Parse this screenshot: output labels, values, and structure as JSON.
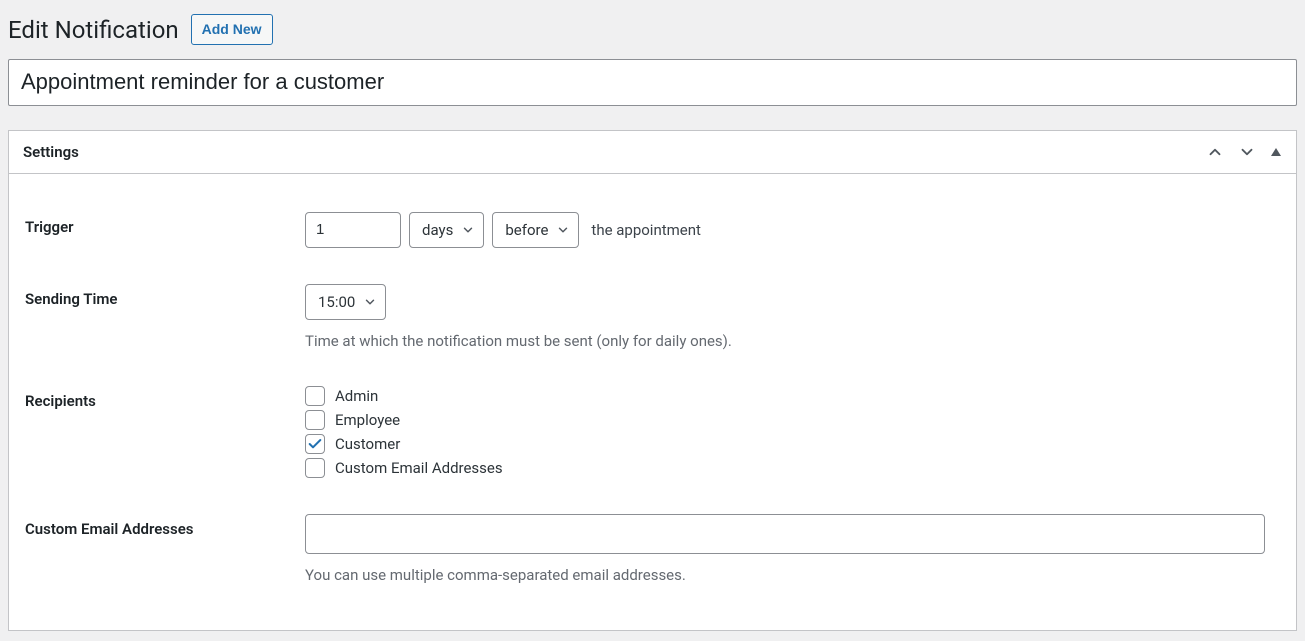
{
  "header": {
    "title": "Edit Notification",
    "add_new_label": "Add New",
    "notification_name": "Appointment reminder for a customer"
  },
  "panel": {
    "title": "Settings"
  },
  "trigger": {
    "label": "Trigger",
    "number": "1",
    "unit": "days",
    "relation": "before",
    "suffix": "the appointment"
  },
  "sending_time": {
    "label": "Sending Time",
    "value": "15:00",
    "help": "Time at which the notification must be sent (only for daily ones)."
  },
  "recipients": {
    "label": "Recipients",
    "options": [
      {
        "label": "Admin",
        "checked": false
      },
      {
        "label": "Employee",
        "checked": false
      },
      {
        "label": "Customer",
        "checked": true
      },
      {
        "label": "Custom Email Addresses",
        "checked": false
      }
    ]
  },
  "custom_email": {
    "label": "Custom Email Addresses",
    "value": "",
    "help": "You can use multiple comma-separated email addresses."
  }
}
